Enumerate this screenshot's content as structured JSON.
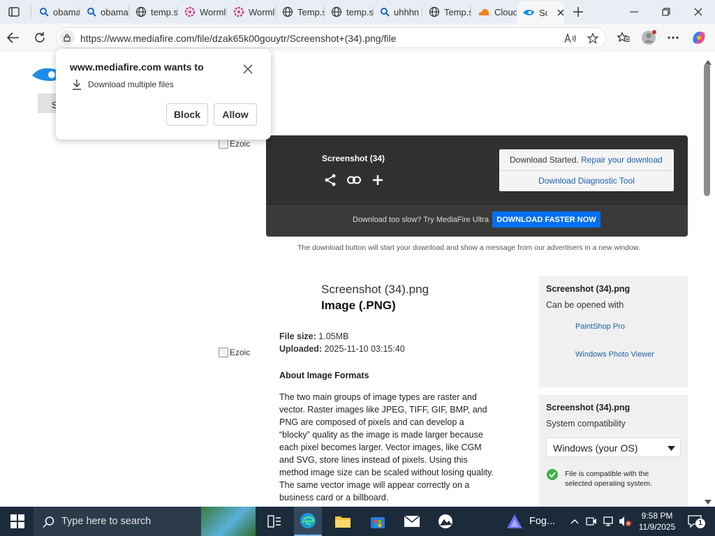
{
  "browser": {
    "tabs": [
      {
        "label": "obama",
        "icon": "search-icon"
      },
      {
        "label": "obama",
        "icon": "search-icon"
      },
      {
        "label": "temp.s",
        "icon": "globe-icon"
      },
      {
        "label": "Worml",
        "icon": "flower-icon"
      },
      {
        "label": "Worml",
        "icon": "flower-icon"
      },
      {
        "label": "Temp.s",
        "icon": "globe-icon"
      },
      {
        "label": "temp.s",
        "icon": "globe-icon"
      },
      {
        "label": "uhhhn",
        "icon": "search-icon"
      },
      {
        "label": "Temp.s",
        "icon": "globe-icon"
      },
      {
        "label": "Cloud",
        "icon": "cloudflare-icon"
      },
      {
        "label": "Sc",
        "icon": "mediafire-icon"
      }
    ],
    "url": "https://www.mediafire.com/file/dzak65k00gouytr/Screenshot+(34).png/file"
  },
  "popup": {
    "title": "www.mediafire.com wants to",
    "permission": "Download multiple files",
    "block_label": "Block",
    "allow_label": "Allow"
  },
  "page": {
    "nav_partial": "S",
    "ad_alt_1": "Ezoic",
    "ad_alt_2": "Ezoic",
    "download_card": {
      "file_name": "Screenshot (34)",
      "status": "Download Started.",
      "repair_link": "Repair your download",
      "diagnostic_link": "Download Diagnostic Tool",
      "slow_text": "Download too slow? Try MediaFire Ultra",
      "faster_button": "DOWNLOAD FASTER NOW"
    },
    "disclaimer": "The download button will start your download and show a message from our advertisers in a new window.",
    "file_info": {
      "title": "Screenshot (34).png",
      "type": "Image (.PNG)",
      "size_label": "File size:",
      "size_value": "1.05MB",
      "uploaded_label": "Uploaded:",
      "uploaded_value": "2025-11-10 03:15:40",
      "about_heading": "About Image Formats",
      "about_lines": [
        "The two main groups of image types are raster and",
        "vector. Raster images like JPEG, TIFF, GIF, BMP, and",
        "PNG are composed of pixels and can develop a",
        "“blocky” quality as the image is made larger because",
        "each pixel becomes larger. Vector images, like CGM",
        "and SVG, store lines instead of pixels. Using this",
        "method image size can be scaled without losing quality.",
        "The same vector image will appear correctly on a",
        "business card or a billboard."
      ]
    },
    "open_with": {
      "title": "Screenshot (34).png",
      "subtitle": "Can be opened with",
      "apps": [
        "PaintShop Pro",
        "Windows Photo Viewer"
      ]
    },
    "compat": {
      "title": "Screenshot (34).png",
      "subtitle": "System compatibility",
      "os_selected": "Windows (your OS)",
      "compat_line1": "File is compatible with the",
      "compat_line2": "selected operating system."
    }
  },
  "taskbar": {
    "search_placeholder": "Type here to search",
    "fog_label": "Fog...",
    "time": "9:58 PM",
    "date": "11/9/2025",
    "notification_count": "1"
  },
  "colors": {
    "accent_blue": "#0070f0",
    "link_blue": "#1f5fad",
    "card_dark": "#303030",
    "check_green": "#3db14a"
  }
}
